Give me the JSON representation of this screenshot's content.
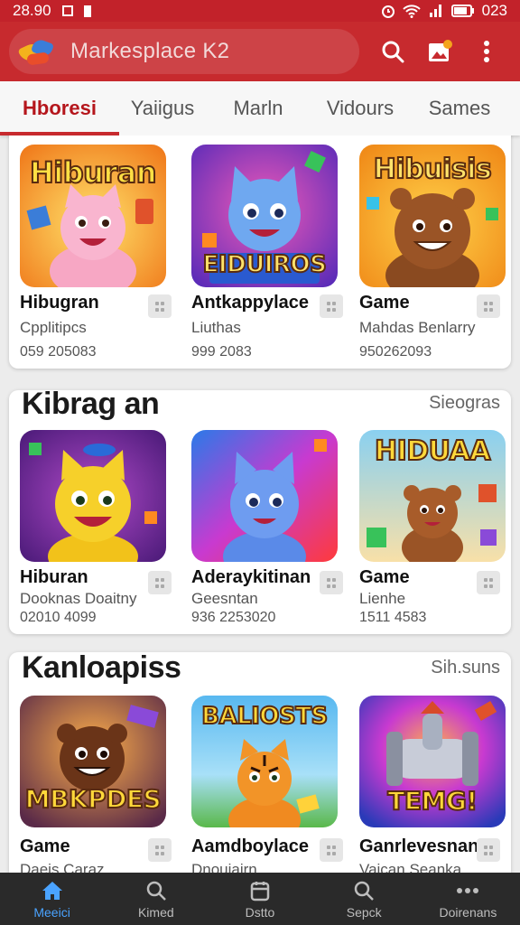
{
  "status_bar": {
    "time": "28.90",
    "battery": "023"
  },
  "app_bar": {
    "title": "Markesplace  K2"
  },
  "tabs": [
    "Hboresi",
    "Yaiigus",
    "Marln",
    "Vidours",
    "Sames"
  ],
  "sections": [
    {
      "title": "",
      "link": "",
      "items": [
        {
          "name": "Hibugran",
          "sub": "Cpplitipcs",
          "num": "059 205083",
          "thumb_text": "Hiburan",
          "theme": "orange-pink"
        },
        {
          "name": "Antkappylace",
          "sub": "Liuthas",
          "num": "999 2083",
          "thumb_text": "EIDUIROS",
          "theme": "purple-blue"
        },
        {
          "name": "Game",
          "sub": "Mahdas Benlarry",
          "num": "950262093",
          "thumb_text": "Hibuisis",
          "theme": "amber-brown"
        }
      ]
    },
    {
      "title": "Kibrag an",
      "link": "Sieogras",
      "items": [
        {
          "name": "Hiburan",
          "sub": "Dooknas Doaitny",
          "num": "02010 4099",
          "thumb_text": "",
          "theme": "purple-yellow"
        },
        {
          "name": "Aderaykitinan",
          "sub": "Geesntan",
          "num": "936 2253020",
          "thumb_text": "",
          "theme": "red-blue"
        },
        {
          "name": "Game",
          "sub": "Lienhe",
          "num": "1511 4583",
          "thumb_text": "HIDUAA",
          "theme": "cream-brown"
        }
      ]
    },
    {
      "title": "Kanloapiss",
      "link": "Sih.suns",
      "items": [
        {
          "name": "Game",
          "sub": "Daeis Caraz",
          "num": "",
          "thumb_text": "MBKPDES",
          "theme": "dusk-bear"
        },
        {
          "name": "Aamdboylace",
          "sub": "Dnouiairn",
          "num": "",
          "thumb_text": "BALIOSTS",
          "theme": "sky-tiger"
        },
        {
          "name": "Ganrlevesnant",
          "sub": "Vaican Seanka",
          "num": "",
          "thumb_text": "TEMG!",
          "theme": "violet-rocket"
        }
      ]
    }
  ],
  "bottom_nav": [
    {
      "label": "Meeici",
      "icon": "home-icon",
      "active": true
    },
    {
      "label": "Kimed",
      "icon": "search-icon",
      "active": false
    },
    {
      "label": "Dstto",
      "icon": "calendar-icon",
      "active": false
    },
    {
      "label": "Sepck",
      "icon": "search-icon",
      "active": false
    },
    {
      "label": "Doirenans",
      "icon": "more-icon",
      "active": false
    }
  ],
  "colors": {
    "brand_red": "#c72a2e",
    "active_blue": "#4aa3ff"
  }
}
